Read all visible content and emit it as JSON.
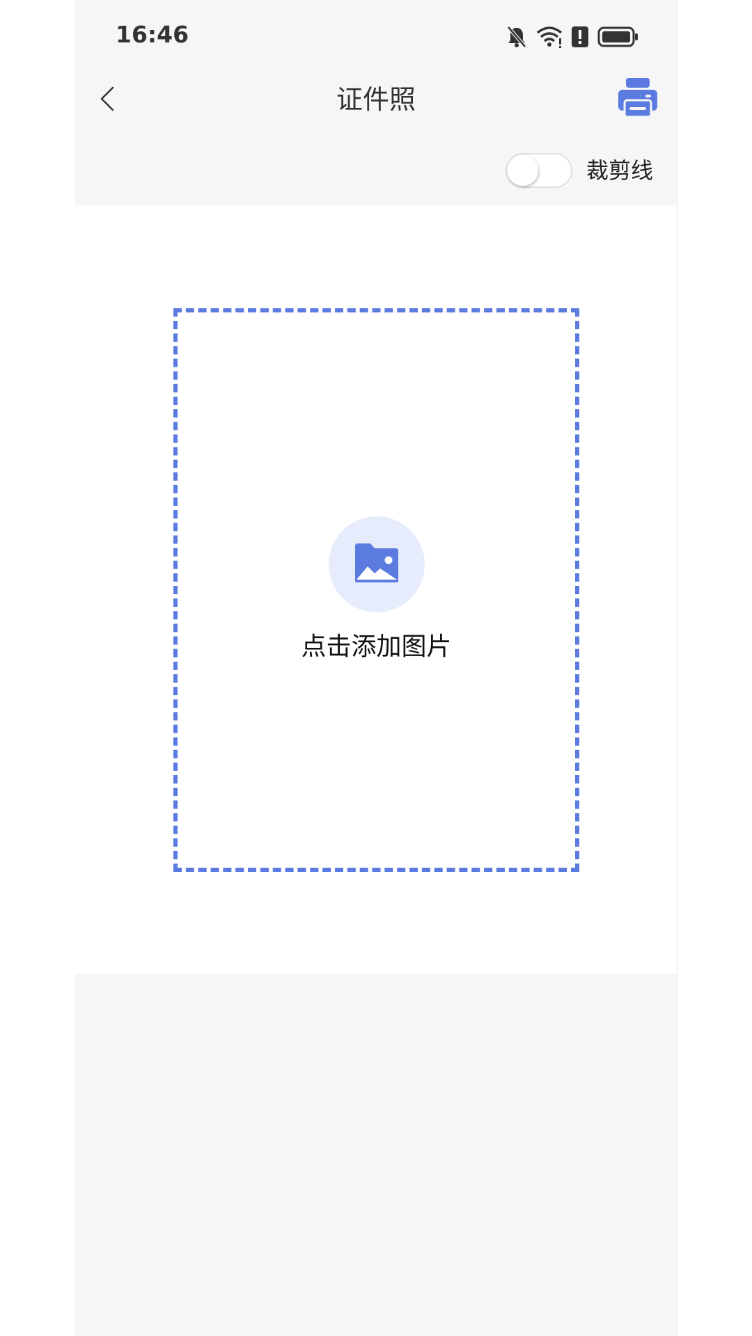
{
  "status_bar": {
    "time": "16:46",
    "icons": [
      "bell-muted-icon",
      "wifi-icon",
      "alert-icon",
      "battery-icon"
    ]
  },
  "nav": {
    "title": "证件照",
    "back_icon": "chevron-left-icon",
    "print_icon": "printer-icon"
  },
  "toolbar": {
    "crop_lines_label": "裁剪线",
    "crop_lines_enabled": false
  },
  "main": {
    "add_image_label": "点击添加图片",
    "add_image_icon": "image-icon"
  },
  "colors": {
    "accent": "#5b7be0",
    "icon_bg": "#e6ecfb",
    "app_bg": "#f6f6f6",
    "content_bg": "#ffffff"
  }
}
